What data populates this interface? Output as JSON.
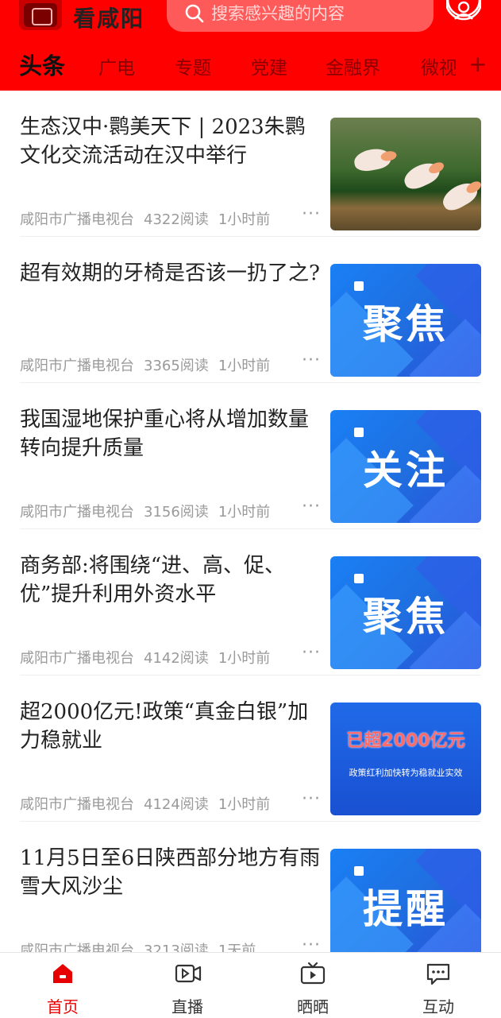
{
  "header": {
    "app_title": "看咸阳",
    "search_placeholder": "搜索感兴趣的内容",
    "accent_color": "#ff0000"
  },
  "tabs": [
    {
      "label": "头条",
      "active": true
    },
    {
      "label": "广电"
    },
    {
      "label": "专题"
    },
    {
      "label": "党建"
    },
    {
      "label": "金融界"
    },
    {
      "label": "微视"
    }
  ],
  "tab_more": "+",
  "articles": [
    {
      "title": "生态汉中·鹮美天下 | 2023朱鹮文化交流活动在汉中举行",
      "source": "咸阳市广播电视台",
      "reads": "4322阅读",
      "time": "1小时前",
      "thumb_type": "photo",
      "thumb_text": ""
    },
    {
      "title": "超有效期的牙椅是否该一扔了之?",
      "source": "咸阳市广播电视台",
      "reads": "3365阅读",
      "time": "1小时前",
      "thumb_type": "blue",
      "thumb_text": "聚焦"
    },
    {
      "title": "我国湿地保护重心将从增加数量转向提升质量",
      "source": "咸阳市广播电视台",
      "reads": "3156阅读",
      "time": "1小时前",
      "thumb_type": "blue",
      "thumb_text": "关注"
    },
    {
      "title": "商务部:将围绕“进、高、促、优”提升利用外资水平",
      "source": "咸阳市广播电视台",
      "reads": "4142阅读",
      "time": "1小时前",
      "thumb_type": "blue",
      "thumb_text": "聚焦"
    },
    {
      "title": "超2000亿元!政策“真金白银”加力稳就业",
      "source": "咸阳市广播电视台",
      "reads": "4124阅读",
      "time": "1小时前",
      "thumb_type": "promo",
      "thumb_text": "已超2000亿元",
      "thumb_subtext": "政策红利加快转为稳就业实效"
    },
    {
      "title": "11月5日至6日陕西部分地方有雨雪大风沙尘",
      "source": "咸阳市广播电视台",
      "reads": "3213阅读",
      "time": "1天前",
      "thumb_type": "blue",
      "thumb_text": "提醒"
    }
  ],
  "more_glyph": "···",
  "bottom_nav": [
    {
      "label": "首页",
      "icon": "home-icon",
      "active": true
    },
    {
      "label": "直播",
      "icon": "video-camera-icon"
    },
    {
      "label": "晒晒",
      "icon": "tv-icon"
    },
    {
      "label": "互动",
      "icon": "chat-bubble-icon"
    }
  ]
}
